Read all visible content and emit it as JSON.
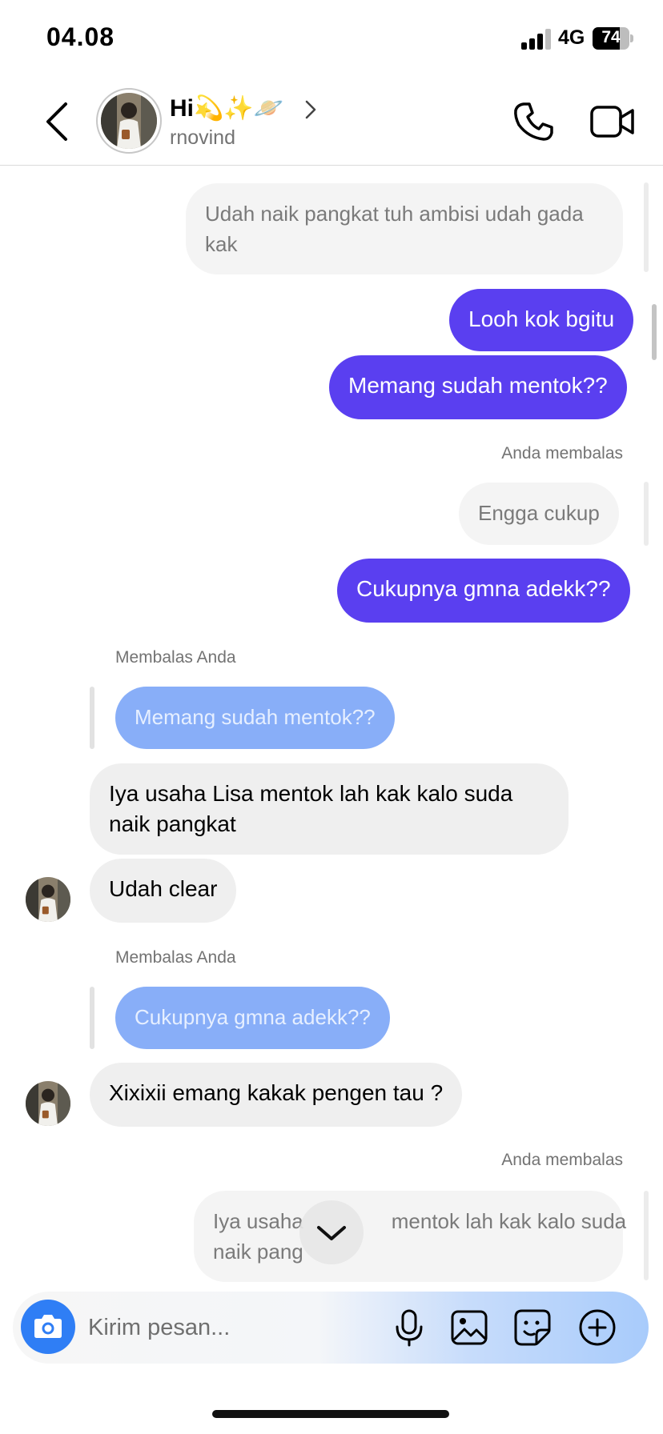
{
  "status_bar": {
    "time": "04.08",
    "network": "4G",
    "battery": "74"
  },
  "header": {
    "name": "Hi💫✨🪐",
    "username": "rnovind"
  },
  "messages": [
    {
      "kind": "faded",
      "lines": [
        "Udah naik pangkat tuh ambisi udah gada",
        "kak"
      ]
    },
    {
      "kind": "out",
      "text": "Looh kok bgitu"
    },
    {
      "kind": "out",
      "text": "Memang sudah mentok??"
    },
    {
      "kind": "label",
      "text": "Anda membalas"
    },
    {
      "kind": "faded",
      "text": "Engga cukup"
    },
    {
      "kind": "out",
      "text": "Cukupnya gmna adekk??"
    },
    {
      "kind": "label",
      "text": "Membalas Anda"
    },
    {
      "kind": "quoted",
      "text": "Memang sudah mentok??"
    },
    {
      "kind": "in",
      "lines": [
        "Iya usaha Lisa mentok lah kak kalo suda",
        "naik pangkat"
      ]
    },
    {
      "kind": "in",
      "text": "Udah clear"
    },
    {
      "kind": "label",
      "text": "Membalas Anda"
    },
    {
      "kind": "quoted",
      "text": "Cukupnya gmna adekk??"
    },
    {
      "kind": "in",
      "text": "Xixixii emang kakak pengen tau ?"
    },
    {
      "kind": "label",
      "text": "Anda membalas"
    },
    {
      "kind": "faded",
      "lines": [
        "Iya usaha",
        "mentok lah kak kalo suda",
        "naik pang"
      ]
    }
  ],
  "composer": {
    "placeholder": "Kirim pesan..."
  },
  "icons": {
    "back": "chevron-left-icon",
    "call": "phone-icon",
    "video": "video-camera-icon",
    "camera": "camera-icon",
    "mic": "microphone-icon",
    "gallery": "image-icon",
    "sticker": "sticker-icon",
    "more": "plus-circle-icon",
    "scroll_down": "chevron-down-icon"
  },
  "colors": {
    "outgoing_bubble": "#5a3ff0",
    "quoted_bubble": "#88aef8",
    "incoming_bubble": "#efefef",
    "camera_button": "#2f7ef5"
  }
}
